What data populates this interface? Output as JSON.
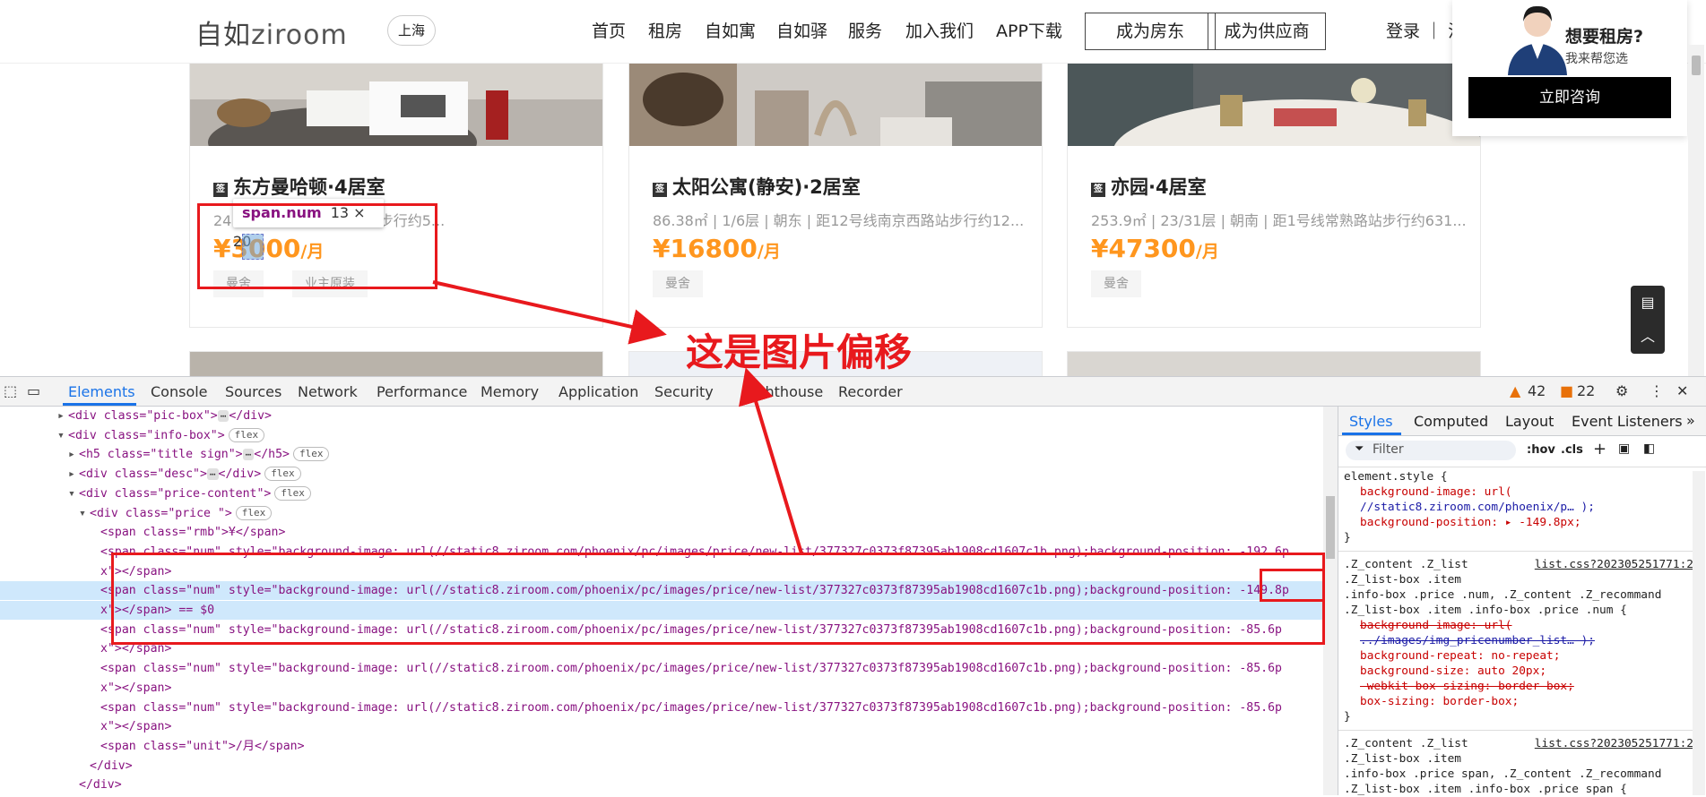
{
  "header": {
    "logo_cn": "自如",
    "logo_en": "ziroom",
    "city": "上海",
    "nav": [
      "首页",
      "租房",
      "自如寓",
      "自如驿",
      "服务",
      "加入我们",
      "APP下载"
    ],
    "btn_landlord": "成为房东",
    "btn_supplier": "成为供应商",
    "login": "登录 ｜ 注"
  },
  "listings": [
    {
      "sign": "签",
      "title": "东方曼哈顿·4居室",
      "desc": "24…｜距11号线徐家汇站步行约5...",
      "price_prefix": "¥3",
      "price_rest": "000",
      "unit": "/月",
      "tags": [
        "曼舍",
        "业主原装"
      ]
    },
    {
      "sign": "签",
      "title": "太阳公寓(静安)·2居室",
      "desc": "86.38㎡ | 1/6层 | 朝东 | 距12号线南京西路站步行约12...",
      "price_prefix": "¥",
      "price_rest": "16800",
      "unit": "/月",
      "tags": [
        "曼舍"
      ]
    },
    {
      "sign": "签",
      "title": "亦园·4居室",
      "desc": "253.9㎡ | 23/31层 | 朝南 | 距1号线常熟路站步行约631...",
      "price_prefix": "¥",
      "price_rest": "47300",
      "unit": "/月",
      "tags": [
        "曼舍"
      ]
    }
  ],
  "inspector_tooltip": {
    "selector": "span.num",
    "size": "13 × 20"
  },
  "annotation": "这是图片偏移",
  "consult": {
    "question": "想要租房?",
    "sub": "我来帮您选",
    "button": "立即咨询"
  },
  "devtools": {
    "tabs": [
      "Elements",
      "Console",
      "Sources",
      "Network",
      "Performance",
      "Memory",
      "Application",
      "Security",
      "Lighthouse",
      "Recorder"
    ],
    "warnings": "42",
    "errors": "22",
    "dom_lines": [
      {
        "indent": 6,
        "arrow": "▸",
        "html": "<div class=\"pic-box\">",
        "dots": true,
        "close": "</div>",
        "badge": ""
      },
      {
        "indent": 6,
        "arrow": "▾",
        "html": "<div class=\"info-box\">",
        "dots": false,
        "close": "",
        "badge": "flex"
      },
      {
        "indent": 7,
        "arrow": "▸",
        "html": "<h5 class=\"title sign\">",
        "dots": true,
        "close": "</h5>",
        "badge": "flex"
      },
      {
        "indent": 7,
        "arrow": "▸",
        "html": "<div class=\"desc\">",
        "dots": true,
        "close": "</div>",
        "badge": "flex"
      },
      {
        "indent": 7,
        "arrow": "▾",
        "html": "<div class=\"price-content\">",
        "dots": false,
        "close": "",
        "badge": "flex"
      },
      {
        "indent": 8,
        "arrow": "▾",
        "html": "<div class=\"price \">",
        "dots": false,
        "close": "",
        "badge": "flex"
      },
      {
        "indent": 9,
        "arrow": "",
        "html": "<span class=\"rmb\">¥</span>",
        "dots": false,
        "close": "",
        "badge": ""
      },
      {
        "indent": 9,
        "arrow": "",
        "html": "<span class=\"num\" style=\"background-image: url(//static8.ziroom.com/phoenix/pc/images/price/new-list/377327c0373f87395ab1908cd1607c1b.png);background-position: -192.6p",
        "dots": false,
        "close": "",
        "badge": ""
      },
      {
        "indent": 9,
        "arrow": "",
        "html": "x\"></span>",
        "dots": false,
        "close": "",
        "badge": ""
      },
      {
        "indent": 9,
        "arrow": "",
        "html": "<span class=\"num\" style=\"background-image: url(//static8.ziroom.com/phoenix/pc/images/price/new-list/377327c0373f87395ab1908cd1607c1b.png);background-position: -149.8p",
        "dots": false,
        "close": "",
        "badge": ""
      },
      {
        "indent": 9,
        "arrow": "",
        "html": "x\"></span> == $0",
        "dots": false,
        "close": "",
        "badge": ""
      },
      {
        "indent": 9,
        "arrow": "",
        "html": "<span class=\"num\" style=\"background-image: url(//static8.ziroom.com/phoenix/pc/images/price/new-list/377327c0373f87395ab1908cd1607c1b.png);background-position: -85.6p",
        "dots": false,
        "close": "",
        "badge": ""
      },
      {
        "indent": 9,
        "arrow": "",
        "html": "x\"></span>",
        "dots": false,
        "close": "",
        "badge": ""
      },
      {
        "indent": 9,
        "arrow": "",
        "html": "<span class=\"num\" style=\"background-image: url(//static8.ziroom.com/phoenix/pc/images/price/new-list/377327c0373f87395ab1908cd1607c1b.png);background-position: -85.6p",
        "dots": false,
        "close": "",
        "badge": ""
      },
      {
        "indent": 9,
        "arrow": "",
        "html": "x\"></span>",
        "dots": false,
        "close": "",
        "badge": ""
      },
      {
        "indent": 9,
        "arrow": "",
        "html": "<span class=\"num\" style=\"background-image: url(//static8.ziroom.com/phoenix/pc/images/price/new-list/377327c0373f87395ab1908cd1607c1b.png);background-position: -85.6p",
        "dots": false,
        "close": "",
        "badge": ""
      },
      {
        "indent": 9,
        "arrow": "",
        "html": "x\"></span>",
        "dots": false,
        "close": "",
        "badge": ""
      },
      {
        "indent": 9,
        "arrow": "",
        "html": "<span class=\"unit\">/月</span>",
        "dots": false,
        "close": "",
        "badge": ""
      },
      {
        "indent": 8,
        "arrow": "",
        "html": "</div>",
        "dots": false,
        "close": "",
        "badge": ""
      },
      {
        "indent": 7,
        "arrow": "",
        "html": "</div>",
        "dots": false,
        "close": "",
        "badge": ""
      },
      {
        "indent": 7,
        "arrow": "▸",
        "html": "<div class=\"tag\">",
        "dots": true,
        "close": "</div>",
        "badge": "flex"
      }
    ],
    "styles_tabs": [
      "Styles",
      "Computed",
      "Layout",
      "Event Listeners"
    ],
    "filter_placeholder": "Filter",
    "filter_tools": [
      ":hov",
      ".cls"
    ],
    "style_rules": [
      {
        "selector": "element.style {",
        "source": "",
        "props": [
          {
            "text": "background-image: url(",
            "strike": false
          },
          {
            "text": "    //static8.ziroom.com/phoenix/p… );",
            "strike": false,
            "link": true
          },
          {
            "text": "background-position: ▸ -149.8px;",
            "strike": false
          }
        ],
        "close": "}"
      },
      {
        "selector": ".Z_content .Z_list",
        "source": "list.css?202305251771:2",
        "extra": [
          ".Z_list-box .item",
          ".info-box .price .num, .Z_content .Z_recommand",
          ".Z_list-box .item .info-box .price .num {"
        ],
        "props": [
          {
            "text": "background-image: url(",
            "strike": true
          },
          {
            "text": "    ../images/img_pricenumber_list… );",
            "strike": true,
            "link": true
          },
          {
            "text": "background-repeat: no-repeat;",
            "strike": false
          },
          {
            "text": "background-size: auto 20px;",
            "strike": false
          },
          {
            "text": "-webkit-box-sizing: border-box;",
            "strike": true
          },
          {
            "text": "box-sizing: border-box;",
            "strike": false
          }
        ],
        "close": "}"
      },
      {
        "selector": ".Z_content .Z_list",
        "source": "list.css?202305251771:2",
        "extra": [
          ".Z_list-box .item",
          ".info-box .price span, .Z_content .Z_recommand",
          ".Z_list-box .item .info-box .price span {"
        ],
        "props": [],
        "close": ""
      }
    ]
  },
  "colors": {
    "price": "#ff961e",
    "annotation": "#e8191d",
    "devtools_accent": "#1a73e8"
  }
}
